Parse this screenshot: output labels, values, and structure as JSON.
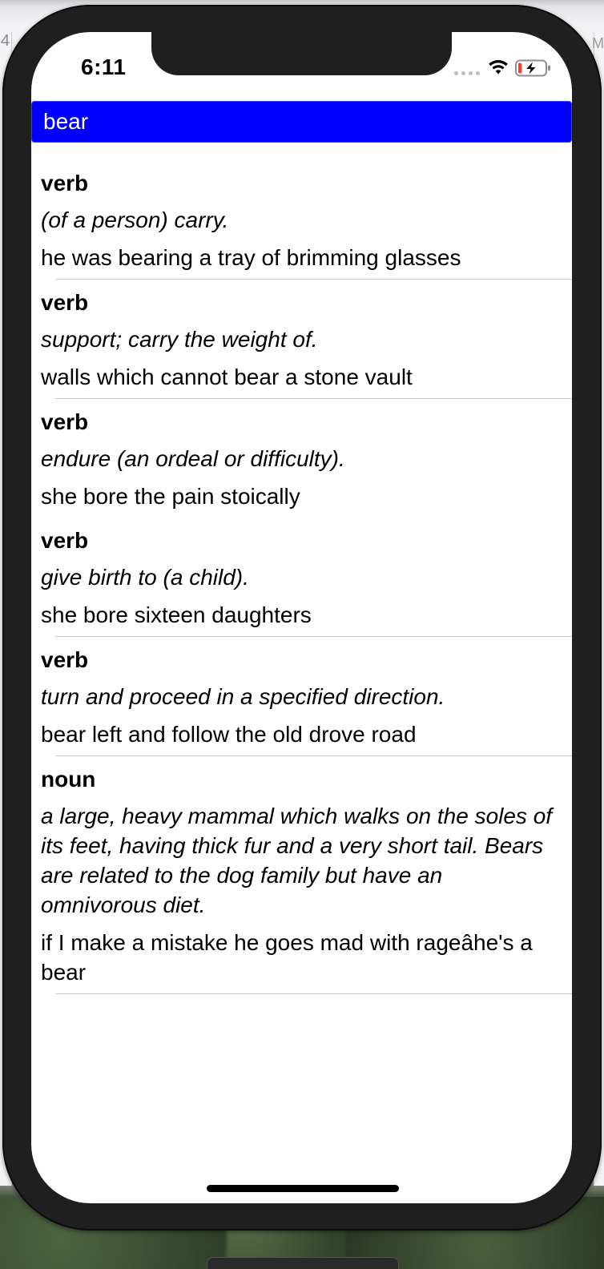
{
  "background": {
    "left_edge_text": "4",
    "right_edge_text": "M"
  },
  "status_bar": {
    "time": "6:11",
    "wifi_icon": "wifi-icon",
    "battery_icon": "battery-charging-icon"
  },
  "search": {
    "value": "bear",
    "background_color": "#0000ff",
    "text_color": "#ffffff"
  },
  "entries": [
    {
      "pos": "verb",
      "definition": "(of a person) carry.",
      "example": "he was bearing a tray of brimming glasses",
      "divider": true
    },
    {
      "pos": "verb",
      "definition": "support; carry the weight of.",
      "example": "walls which cannot bear a stone vault",
      "divider": true
    },
    {
      "pos": "verb",
      "definition": "endure (an ordeal or difficulty).",
      "example": "she bore the pain stoically",
      "divider": false
    },
    {
      "pos": "verb",
      "definition": "give birth to (a child).",
      "example": "she bore sixteen daughters",
      "divider": true
    },
    {
      "pos": "verb",
      "definition": "turn and proceed in a specified direction.",
      "example": "bear left and follow the old drove road",
      "divider": true
    },
    {
      "pos": "noun",
      "definition": "a large, heavy mammal which walks on the soles of its feet, having thick fur and a very short tail. Bears are related to the dog family but have an omnivorous diet.",
      "example": "if I make a mistake he goes mad with rageâhe's a bear",
      "divider": true
    }
  ]
}
